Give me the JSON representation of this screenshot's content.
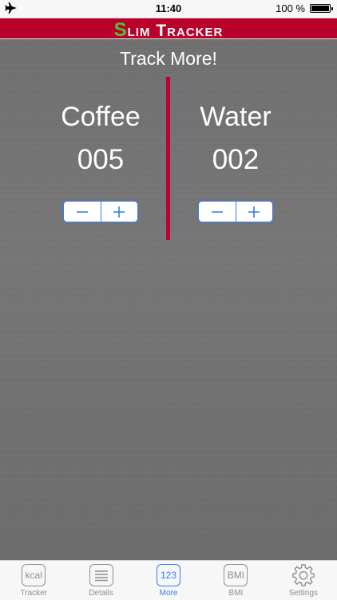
{
  "status_bar": {
    "time": "11:40",
    "battery": "100 %"
  },
  "header": {
    "title_accent": "S",
    "title_rest": "lim Tracker"
  },
  "subtitle": "Track More!",
  "counters": [
    {
      "label": "Coffee",
      "value": "005"
    },
    {
      "label": "Water",
      "value": "002"
    }
  ],
  "tabs": [
    {
      "label": "Tracker",
      "icon_text": "kcal",
      "icon": "kcal-icon"
    },
    {
      "label": "Details",
      "icon_text": "",
      "icon": "list-icon"
    },
    {
      "label": "More",
      "icon_text": "123",
      "icon": "counter-icon",
      "active": true
    },
    {
      "label": "BMI",
      "icon_text": "BMI",
      "icon": "bmi-icon"
    },
    {
      "label": "Settings",
      "icon_text": "",
      "icon": "gear-icon"
    }
  ],
  "colors": {
    "brand_red": "#b8002a",
    "accent_green": "#57c03a",
    "ios_blue": "#2f7cf6"
  }
}
